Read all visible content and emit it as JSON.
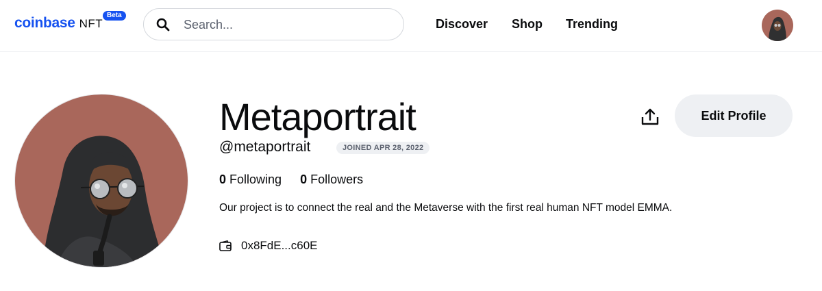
{
  "header": {
    "logo_word": "coinbase",
    "logo_suffix": "NFT",
    "beta_badge": "Beta",
    "search": {
      "placeholder": "Search..."
    },
    "nav": {
      "discover": "Discover",
      "shop": "Shop",
      "trending": "Trending"
    }
  },
  "profile": {
    "name": "Metaportrait",
    "handle": "@metaportrait",
    "joined": "JOINED APR 28, 2022",
    "following_count": "0",
    "following_label": "Following",
    "followers_count": "0",
    "followers_label": "Followers",
    "bio": "Our project is to connect the real and the Metaverse with the first real human NFT model EMMA.",
    "wallet_address": "0x8FdE...c60E",
    "edit_button": "Edit Profile"
  },
  "icons": {
    "search": "search-icon",
    "share": "share-icon",
    "wallet": "wallet-icon"
  },
  "colors": {
    "brand": "#1652f0",
    "avatar_background": "#a9675b",
    "button_background": "#eef0f3"
  }
}
